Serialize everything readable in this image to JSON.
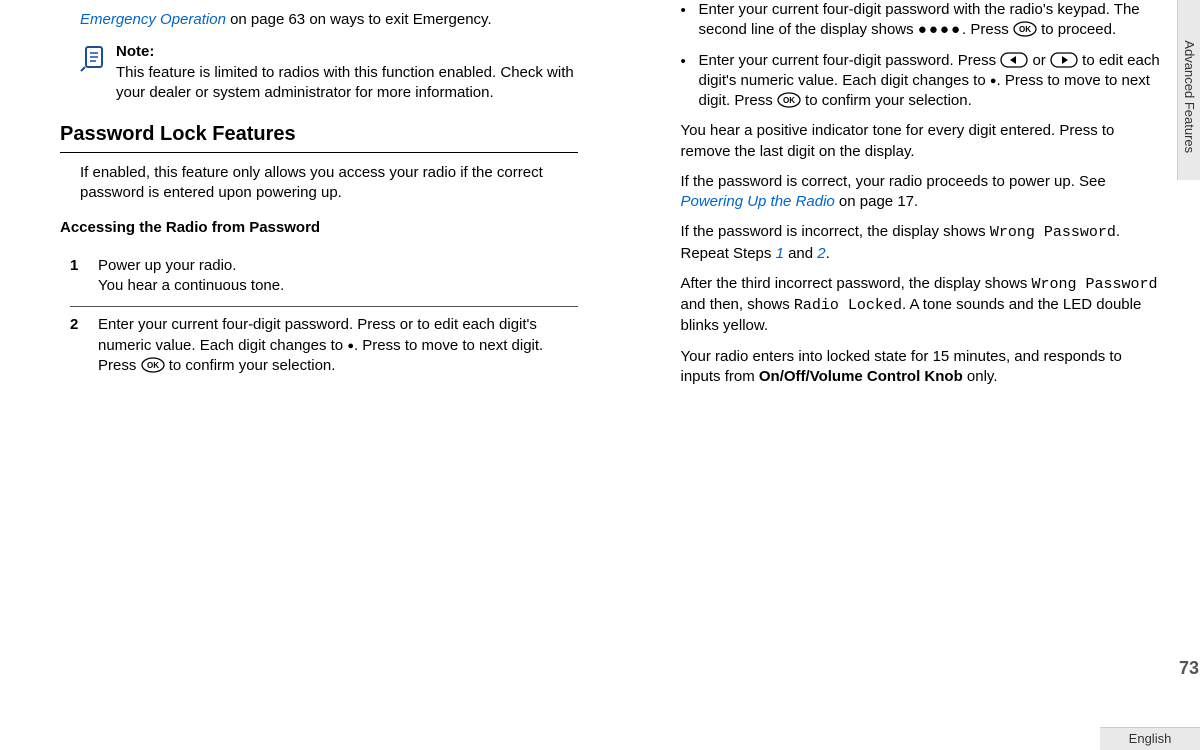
{
  "left": {
    "frag1_linktext": "Emergency Operation",
    "frag1_rest": " on page 63 on ways to exit Emergency.",
    "note_title": "Note:",
    "note_body": "This feature is limited to radios with this function enabled. Check with your dealer or system administrator for more information.",
    "h2": "Password Lock Features",
    "intro": "If enabled, this feature only allows you access your radio if the correct password is entered upon powering up.",
    "h3": "Accessing the Radio from Password",
    "step1_num": "1",
    "step1_l1": "Power up your radio.",
    "step1_l2": "You hear a continuous tone.",
    "step2_num": "2",
    "step2_a": "Enter your current four-digit password. Press or to edit each digit's numeric value. Each digit changes to ",
    "step2_b": ". Press to move to next digit. Press ",
    "step2_c": " to confirm your selection.",
    "bul1_a": "Enter your current four-digit password with the radio's keypad. The second line of the display shows ",
    "bul1_b": ". Press ",
    "bul1_c": " to proceed.",
    "bul2_a": "Enter your current four-digit password. Press ",
    "bul2_b": " or ",
    "bul2_c": " to edit each digit's numeric value. Each digit changes to ",
    "bul2_d": ". Press to move to next digit. Press ",
    "bul2_e": " to confirm your selection."
  },
  "right": {
    "p1": "You hear a positive indicator tone for every digit entered. Press to remove the last digit on the display.",
    "p2_a": "If the password is correct, your radio proceeds to power up. See ",
    "p2_link": "Powering Up the Radio",
    "p2_b": " on page 17.",
    "p3_a": "If the password is incorrect, the display shows ",
    "p3_mono": "Wrong Password",
    "p3_b": ". Repeat Steps ",
    "p3_ref1": "1",
    "p3_and": " and ",
    "p3_ref2": "2",
    "p3_c": ".",
    "p4_a": "After the third incorrect password, the display shows ",
    "p4_mono1": "Wrong Password",
    "p4_b": " and then, shows ",
    "p4_mono2": "Radio Locked",
    "p4_c": ". A tone sounds and the LED double blinks yellow.",
    "p5_a": "Your radio enters into locked state for 15 minutes, and responds to inputs from ",
    "p5_bold": "On/Off/Volume Control Knob",
    "p5_b": " only."
  },
  "chrome": {
    "section": "Advanced Features",
    "pagenum": "73",
    "lang": "English"
  }
}
